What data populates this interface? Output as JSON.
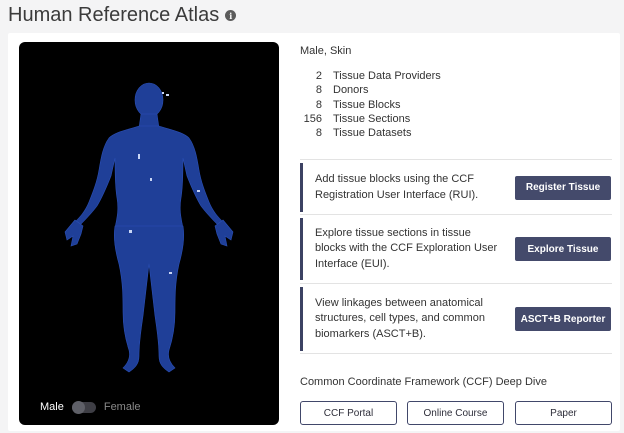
{
  "page": {
    "title": "Human Reference Atlas",
    "info_icon": "i"
  },
  "viewer": {
    "toggle_left": "Male",
    "toggle_right": "Female",
    "colors": {
      "background": "#000000",
      "body": "#1e3f9a"
    }
  },
  "selection": "Male, Skin",
  "stats": [
    {
      "value": "2",
      "label": "Tissue Data Providers"
    },
    {
      "value": "8",
      "label": "Donors"
    },
    {
      "value": "8",
      "label": "Tissue Blocks"
    },
    {
      "value": "156",
      "label": "Tissue Sections"
    },
    {
      "value": "8",
      "label": "Tissue Datasets"
    }
  ],
  "actions": [
    {
      "text": "Add tissue blocks using the CCF Registration User Interface (RUI).",
      "button": "Register Tissue"
    },
    {
      "text": "Explore tissue sections in tissue blocks with the CCF Exploration User Interface (EUI).",
      "button": "Explore Tissue"
    },
    {
      "text": "View linkages between anatomical structures, cell types, and common biomarkers (ASCT+B).",
      "button": "ASCT+B Reporter"
    }
  ],
  "deep_dive": {
    "title": "Common Coordinate Framework (CCF) Deep Dive",
    "links": [
      "CCF Portal",
      "Online Course",
      "Paper"
    ]
  },
  "colors": {
    "accent": "#444a6b",
    "accent_border": "#3c4263"
  }
}
